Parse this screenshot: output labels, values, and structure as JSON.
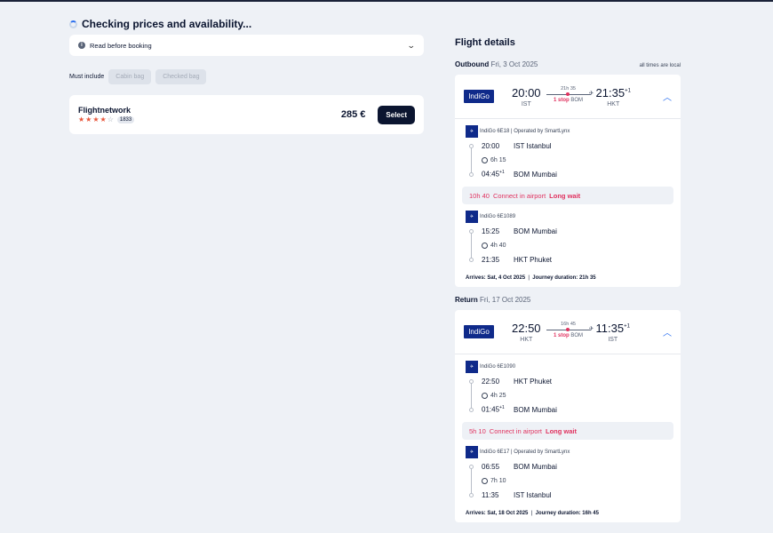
{
  "status": {
    "checking_text": "Checking prices and availability..."
  },
  "notice": {
    "read_before_booking": "Read before booking"
  },
  "filters": {
    "label": "Must include",
    "cabin_bag": "Cabin bag",
    "checked_bag": "Checked bag"
  },
  "deal": {
    "provider": "Flightnetwork",
    "rating": 3.5,
    "rating_max": 5,
    "reviews": "1833",
    "price": "285 €",
    "select_label": "Select"
  },
  "details": {
    "title": "Flight details",
    "local_note": "all times are local",
    "outbound": {
      "label": "Outbound",
      "date": "Fri, 3 Oct 2025",
      "airline": "IndiGo",
      "dep_time": "20:00",
      "dep_code": "IST",
      "arr_time": "21:35",
      "arr_plus": "+1",
      "arr_code": "HKT",
      "duration": "21h 35",
      "stops": "1 stop",
      "stop_code": "BOM",
      "segments": [
        {
          "flight": "IndiGo 6E18 | Operated by SmartLynx",
          "dep_time": "20:00",
          "dep_plus": "",
          "dep_place": "IST Istanbul",
          "duration": "6h 15",
          "arr_time": "04:45",
          "arr_plus": "+1",
          "arr_place": "BOM Mumbai"
        },
        {
          "flight": "IndiGo 6E1089",
          "dep_time": "15:25",
          "dep_plus": "",
          "dep_place": "BOM Mumbai",
          "duration": "4h 40",
          "arr_time": "21:35",
          "arr_plus": "",
          "arr_place": "HKT Phuket"
        }
      ],
      "layover": {
        "duration": "10h 40",
        "text": "Connect in airport",
        "warning": "Long wait"
      },
      "arrives": "Arrives: Sat, 4 Oct 2025",
      "journey": "Journey duration: 21h 35"
    },
    "return": {
      "label": "Return",
      "date": "Fri, 17 Oct 2025",
      "airline": "IndiGo",
      "dep_time": "22:50",
      "dep_code": "HKT",
      "arr_time": "11:35",
      "arr_plus": "+1",
      "arr_code": "IST",
      "duration": "16h 45",
      "stops": "1 stop",
      "stop_code": "BOM",
      "segments": [
        {
          "flight": "IndiGo 6E1090",
          "dep_time": "22:50",
          "dep_plus": "",
          "dep_place": "HKT Phuket",
          "duration": "4h 25",
          "arr_time": "01:45",
          "arr_plus": "+1",
          "arr_place": "BOM Mumbai"
        },
        {
          "flight": "IndiGo 6E17 | Operated by SmartLynx",
          "dep_time": "06:55",
          "dep_plus": "",
          "dep_place": "BOM Mumbai",
          "duration": "7h 10",
          "arr_time": "11:35",
          "arr_plus": "",
          "arr_place": "IST Istanbul"
        }
      ],
      "layover": {
        "duration": "5h 10",
        "text": "Connect in airport",
        "warning": "Long wait"
      },
      "arrives": "Arrives: Sat, 18 Oct 2025",
      "journey": "Journey duration: 16h 45"
    }
  },
  "colors": {
    "accent": "#2a6ff0",
    "warning": "#e0325f",
    "brand_dark": "#0b1530",
    "airline_logo": "#0f2a8a"
  },
  "icons": {
    "spinner": "loading-spinner-icon",
    "info": "info-icon",
    "chevron": "chevron-down-icon",
    "caret": "chevron-up-icon",
    "plane": "plane-icon",
    "clock": "clock-icon"
  }
}
